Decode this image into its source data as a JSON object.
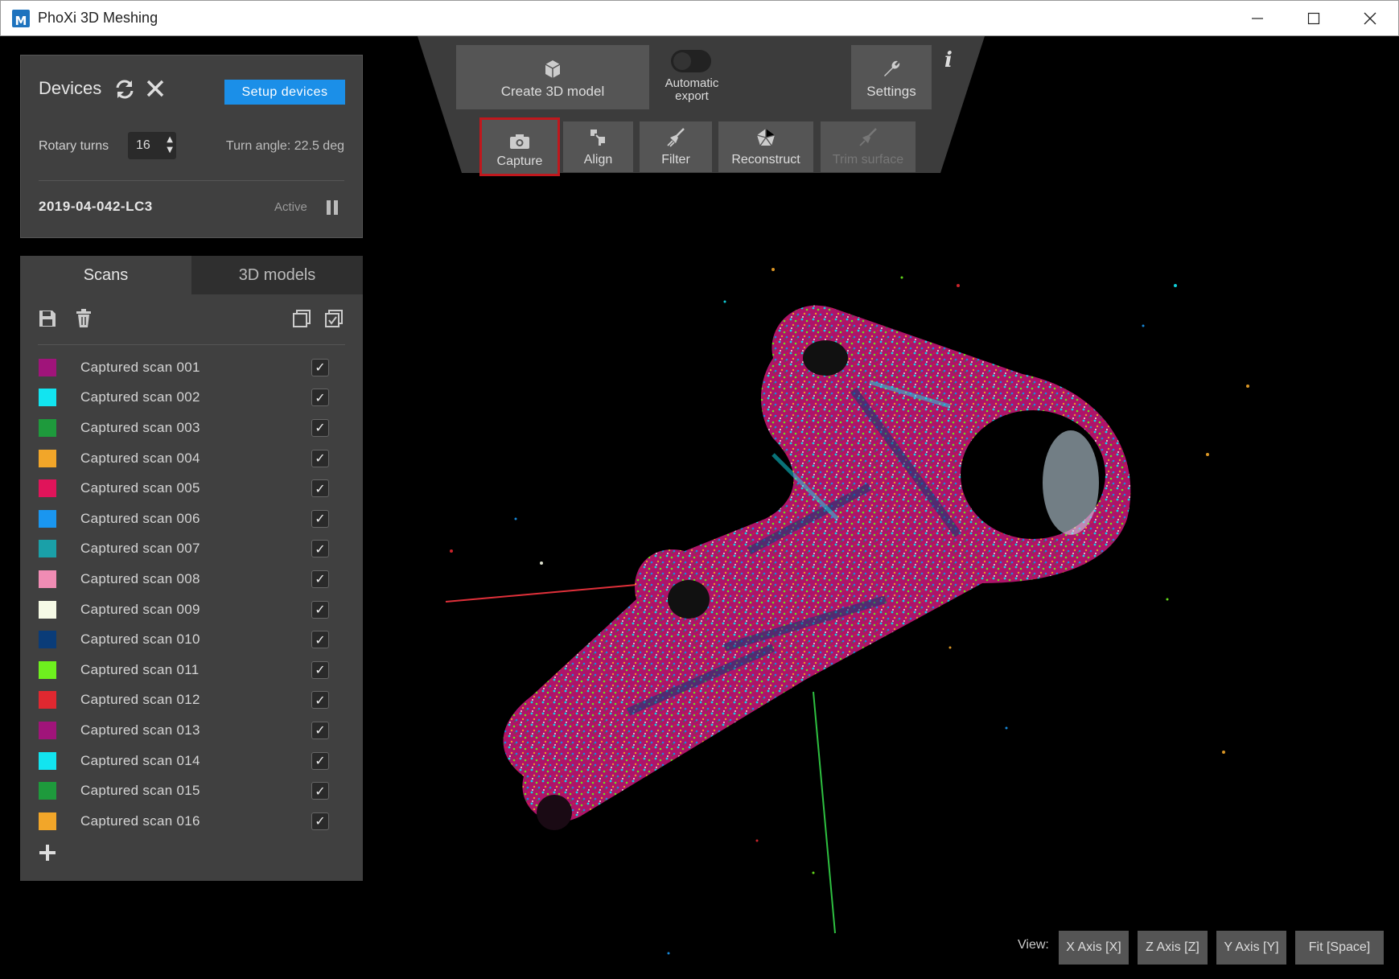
{
  "window": {
    "title": "PhoXi 3D Meshing",
    "logo": "M"
  },
  "devices": {
    "heading": "Devices",
    "setup_label": "Setup devices",
    "rotary_label": "Rotary turns",
    "rotary_value": "16",
    "turn_angle": "Turn angle: 22.5 deg",
    "device_name": "2019-04-042-LC3",
    "device_status": "Active"
  },
  "tabs": {
    "scans": "Scans",
    "models": "3D models"
  },
  "scans": [
    {
      "label": "Captured scan 001",
      "color": "#a0147a",
      "checked": true
    },
    {
      "label": "Captured scan 002",
      "color": "#12e4f0",
      "checked": true
    },
    {
      "label": "Captured scan 003",
      "color": "#1e9a3c",
      "checked": true
    },
    {
      "label": "Captured scan 004",
      "color": "#f2a629",
      "checked": true
    },
    {
      "label": "Captured scan 005",
      "color": "#e0145a",
      "checked": true
    },
    {
      "label": "Captured scan 006",
      "color": "#1a96f0",
      "checked": true
    },
    {
      "label": "Captured scan 007",
      "color": "#1aa0a8",
      "checked": true
    },
    {
      "label": "Captured scan 008",
      "color": "#f08cb4",
      "checked": true
    },
    {
      "label": "Captured scan 009",
      "color": "#f6fae6",
      "checked": true
    },
    {
      "label": "Captured scan 010",
      "color": "#0a3c78",
      "checked": true
    },
    {
      "label": "Captured scan 011",
      "color": "#6ef01e",
      "checked": true
    },
    {
      "label": "Captured scan 012",
      "color": "#e02830",
      "checked": true
    },
    {
      "label": "Captured scan 013",
      "color": "#a0147a",
      "checked": true
    },
    {
      "label": "Captured scan 014",
      "color": "#12e4f0",
      "checked": true
    },
    {
      "label": "Captured scan 015",
      "color": "#1e9a3c",
      "checked": true
    },
    {
      "label": "Captured scan 016",
      "color": "#f2a629",
      "checked": true
    }
  ],
  "toolbar": {
    "create_model": "Create 3D model",
    "auto_export": "Automatic export",
    "auto_export_on": false,
    "settings": "Settings",
    "capture": "Capture",
    "align": "Align",
    "filter": "Filter",
    "reconstruct": "Reconstruct",
    "trim": "Trim surface"
  },
  "view": {
    "label": "View:",
    "x_axis": "X Axis [X]",
    "z_axis": "Z Axis [Z]",
    "y_axis": "Y Axis [Y]",
    "fit": "Fit [Space]"
  }
}
